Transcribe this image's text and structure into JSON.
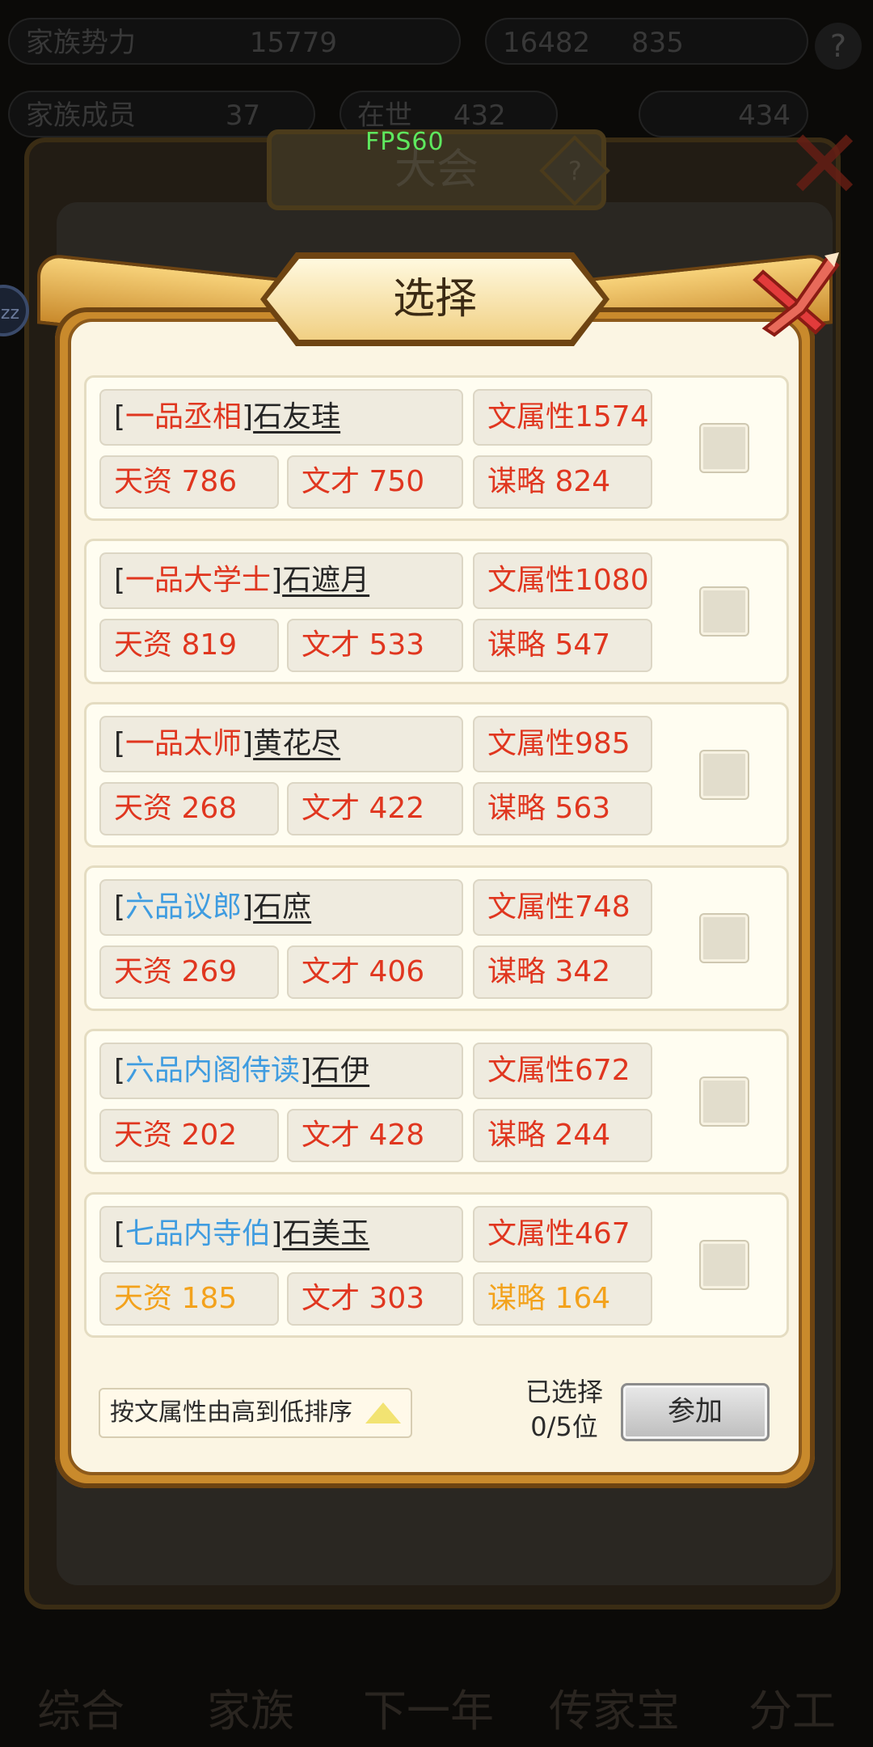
{
  "background": {
    "top_row1": [
      "家族势力",
      "15779",
      "16482",
      "835"
    ],
    "top_row2": [
      "家族成员",
      "37",
      "在世",
      "432",
      "434"
    ],
    "panel_title": "大会",
    "bottom_nav": [
      "综合",
      "家族",
      "下一年",
      "传家宝",
      "分工"
    ]
  },
  "overlay": {
    "fps": "FPS60"
  },
  "dialog": {
    "title": "选择",
    "sort_label": "按文属性由高到低排序",
    "selected_label": "已选择",
    "selected_count": "0/5位",
    "join_label": "参加",
    "members": [
      {
        "rank": "一品丞相",
        "rank_color": "red",
        "name": "石友珪",
        "attr": "文属性1574",
        "s1": "天资 786",
        "s1_color": "red",
        "s2": "文才 750",
        "s2_color": "red",
        "s3": "谋略 824",
        "s3_color": "red",
        "checked": false
      },
      {
        "rank": "一品大学士",
        "rank_color": "red",
        "name": "石遮月",
        "attr": "文属性1080",
        "s1": "天资 819",
        "s1_color": "red",
        "s2": "文才 533",
        "s2_color": "red",
        "s3": "谋略 547",
        "s3_color": "red",
        "checked": false
      },
      {
        "rank": "一品太师",
        "rank_color": "red",
        "name": "黄花尽",
        "attr": "文属性985",
        "s1": "天资 268",
        "s1_color": "red",
        "s2": "文才 422",
        "s2_color": "red",
        "s3": "谋略 563",
        "s3_color": "red",
        "checked": false
      },
      {
        "rank": "六品议郎",
        "rank_color": "blue",
        "name": "石庶",
        "attr": "文属性748",
        "s1": "天资 269",
        "s1_color": "red",
        "s2": "文才 406",
        "s2_color": "red",
        "s3": "谋略 342",
        "s3_color": "red",
        "checked": false
      },
      {
        "rank": "六品内阁侍读",
        "rank_color": "blue",
        "name": "石伊",
        "attr": "文属性672",
        "s1": "天资 202",
        "s1_color": "red",
        "s2": "文才 428",
        "s2_color": "red",
        "s3": "谋略 244",
        "s3_color": "red",
        "checked": false
      },
      {
        "rank": "七品内寺伯",
        "rank_color": "blue",
        "name": "石美玉",
        "attr": "文属性467",
        "s1": "天资 185",
        "s1_color": "orange",
        "s2": "文才 303",
        "s2_color": "red",
        "s3": "谋略 164",
        "s3_color": "orange",
        "checked": false
      }
    ]
  },
  "colors": {
    "red": "#e0361f",
    "orange": "#f3a21c",
    "blue": "#3f9ce0",
    "frame": "#c98a2c",
    "parchment": "#fbf5e3"
  }
}
